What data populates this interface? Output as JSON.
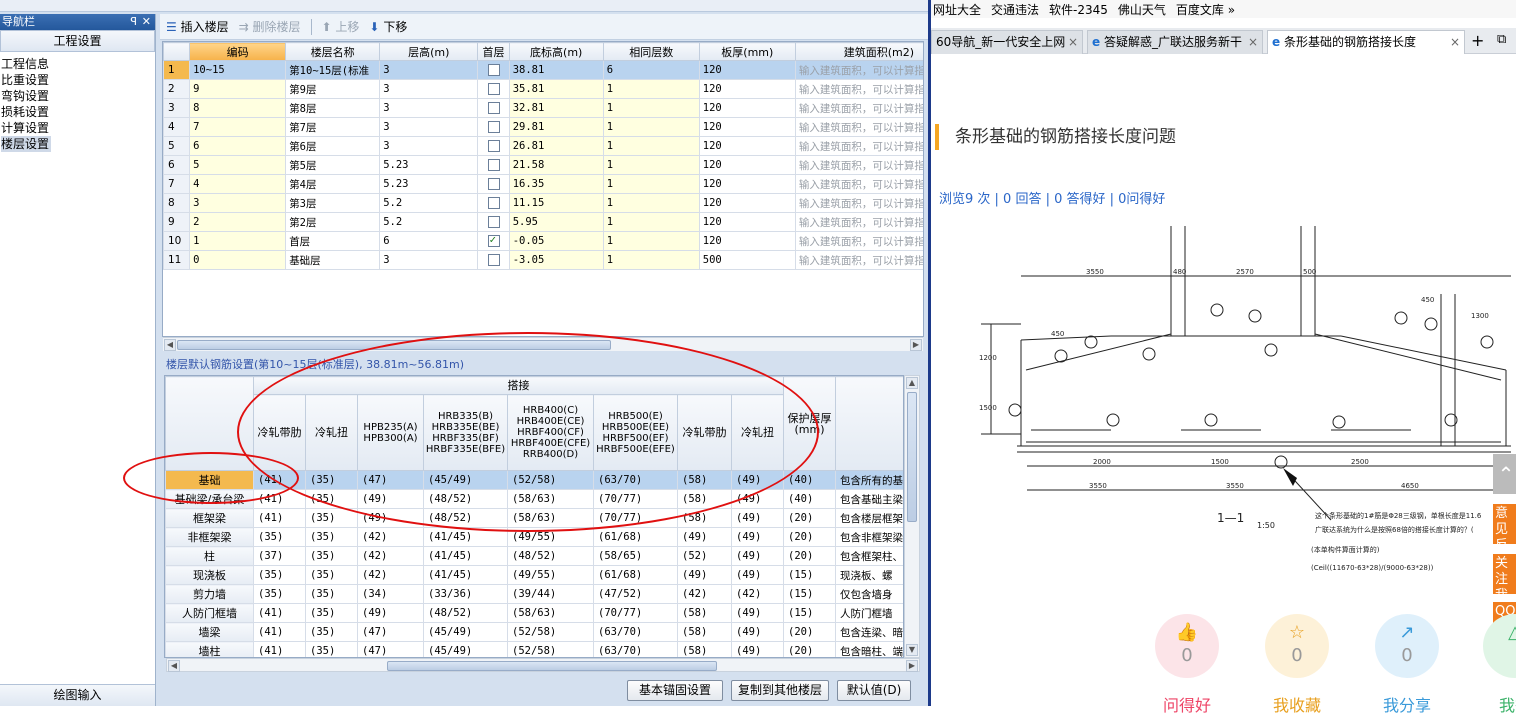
{
  "nav": {
    "title": "导航栏",
    "pin_glyph": "ꟼ",
    "close_glyph": "✕",
    "section_tab": "工程设置",
    "items": [
      "工程信息",
      "比重设置",
      "弯钩设置",
      "损耗设置",
      "计算设置",
      "楼层设置"
    ],
    "selected_index": 5,
    "bottom_tab": "绘图输入"
  },
  "toolbar": {
    "insert_floor": "插入楼层",
    "delete_floor": "删除楼层",
    "move_up": "上移",
    "move_down": "下移"
  },
  "floor_table": {
    "columns": [
      "",
      "编码",
      "楼层名称",
      "层高(m)",
      "首层",
      "底标高(m)",
      "相同层数",
      "板厚(mm)",
      "建筑面积(m2)"
    ],
    "placeholder_area": "输入建筑面积，可以计算指标",
    "rows": [
      {
        "no": "1",
        "code": "10~15",
        "name": "第10~15层(标准",
        "height": "3",
        "first": false,
        "bottom": "38.81",
        "same": "6",
        "thick": "120"
      },
      {
        "no": "2",
        "code": "9",
        "name": "第9层",
        "height": "3",
        "first": false,
        "bottom": "35.81",
        "same": "1",
        "thick": "120"
      },
      {
        "no": "3",
        "code": "8",
        "name": "第8层",
        "height": "3",
        "first": false,
        "bottom": "32.81",
        "same": "1",
        "thick": "120"
      },
      {
        "no": "4",
        "code": "7",
        "name": "第7层",
        "height": "3",
        "first": false,
        "bottom": "29.81",
        "same": "1",
        "thick": "120"
      },
      {
        "no": "5",
        "code": "6",
        "name": "第6层",
        "height": "3",
        "first": false,
        "bottom": "26.81",
        "same": "1",
        "thick": "120"
      },
      {
        "no": "6",
        "code": "5",
        "name": "第5层",
        "height": "5.23",
        "first": false,
        "bottom": "21.58",
        "same": "1",
        "thick": "120"
      },
      {
        "no": "7",
        "code": "4",
        "name": "第4层",
        "height": "5.23",
        "first": false,
        "bottom": "16.35",
        "same": "1",
        "thick": "120"
      },
      {
        "no": "8",
        "code": "3",
        "name": "第3层",
        "height": "5.2",
        "first": false,
        "bottom": "11.15",
        "same": "1",
        "thick": "120"
      },
      {
        "no": "9",
        "code": "2",
        "name": "第2层",
        "height": "5.2",
        "first": false,
        "bottom": "5.95",
        "same": "1",
        "thick": "120"
      },
      {
        "no": "10",
        "code": "1",
        "name": "首层",
        "height": "6",
        "first": true,
        "bottom": "-0.05",
        "same": "1",
        "thick": "120"
      },
      {
        "no": "11",
        "code": "0",
        "name": "基础层",
        "height": "3",
        "first": false,
        "bottom": "-3.05",
        "same": "1",
        "thick": "500"
      }
    ]
  },
  "rebar": {
    "label": "楼层默认钢筋设置(第10~15层(标准层), 38.81m~56.81m)",
    "group_header": "搭接",
    "columns": [
      "冷轧带肋",
      "冷轧扭",
      "HPB235(A)\nHPB300(A)",
      "HRB335(B)\nHRB335E(BE)\nHRBF335(BF)\nHRBF335E(BFE)",
      "HRB400(C)\nHRB400E(CE)\nHRBF400(CF)\nHRBF400E(CFE)\nRRB400(D)",
      "HRB500(E)\nHRB500E(EE)\nHRBF500(EF)\nHRBF500E(EFE)",
      "冷轧带肋",
      "冷轧扭",
      "保护层厚\n(mm)",
      ""
    ],
    "rows": [
      {
        "name": "基础",
        "v": [
          "(41)",
          "(35)",
          "(47)",
          "(45/49)",
          "(52/58)",
          "(63/70)",
          "(58)",
          "(49)",
          "(40)"
        ],
        "desc": "包含所有的基"
      },
      {
        "name": "基础梁/承台梁",
        "v": [
          "(41)",
          "(35)",
          "(49)",
          "(48/52)",
          "(58/63)",
          "(70/77)",
          "(58)",
          "(49)",
          "(40)"
        ],
        "desc": "包含基础主梁"
      },
      {
        "name": "框架梁",
        "v": [
          "(41)",
          "(35)",
          "(49)",
          "(48/52)",
          "(58/63)",
          "(70/77)",
          "(58)",
          "(49)",
          "(20)"
        ],
        "desc": "包含楼层框架"
      },
      {
        "name": "非框架梁",
        "v": [
          "(35)",
          "(35)",
          "(42)",
          "(41/45)",
          "(49/55)",
          "(61/68)",
          "(49)",
          "(49)",
          "(20)"
        ],
        "desc": "包含非框架梁"
      },
      {
        "name": "柱",
        "v": [
          "(37)",
          "(35)",
          "(42)",
          "(41/45)",
          "(48/52)",
          "(58/65)",
          "(52)",
          "(49)",
          "(20)"
        ],
        "desc": "包含框架柱、"
      },
      {
        "name": "现浇板",
        "v": [
          "(35)",
          "(35)",
          "(42)",
          "(41/45)",
          "(49/55)",
          "(61/68)",
          "(49)",
          "(49)",
          "(15)"
        ],
        "desc": "现浇板、螺"
      },
      {
        "name": "剪力墙",
        "v": [
          "(35)",
          "(35)",
          "(34)",
          "(33/36)",
          "(39/44)",
          "(47/52)",
          "(42)",
          "(42)",
          "(15)"
        ],
        "desc": "仅包含墙身"
      },
      {
        "name": "人防门框墙",
        "v": [
          "(41)",
          "(35)",
          "(49)",
          "(48/52)",
          "(58/63)",
          "(70/77)",
          "(58)",
          "(49)",
          "(15)"
        ],
        "desc": "人防门框墙"
      },
      {
        "name": "墙梁",
        "v": [
          "(41)",
          "(35)",
          "(47)",
          "(45/49)",
          "(52/58)",
          "(63/70)",
          "(58)",
          "(49)",
          "(20)"
        ],
        "desc": "包含连梁、暗"
      },
      {
        "name": "墙柱",
        "v": [
          "(41)",
          "(35)",
          "(47)",
          "(45/49)",
          "(52/58)",
          "(63/70)",
          "(58)",
          "(49)",
          "(20)"
        ],
        "desc": "包含暗柱、端"
      }
    ]
  },
  "buttons": {
    "anchor": "基本锚固设置",
    "copy": "复制到其他楼层",
    "default": "默认值(D)"
  },
  "browser": {
    "favorites": [
      "网址大全",
      "交通违法",
      "软件-2345",
      "佛山天气",
      "百度文库 »"
    ],
    "tabs": [
      "60导航_新一代安全上网",
      "答疑解惑_广联达服务新干",
      "条形基础的钢筋搭接长度"
    ],
    "question_title": "条形基础的钢筋搭接长度问题",
    "stats": "浏览9 次 | 0 回答 | 0 答得好 | 0问得好",
    "drawing_notes": [
      "这个条形基础的1#筋是Φ28三级钢，单根长度是11.6",
      "广联达系统为什么是按照68倍的搭接长度计算的？(",
      "(本单构件算面计算的)",
      "(Ceil((11670-63*28)/(9000-63*28))"
    ],
    "section_label": "1—1",
    "section_scale": "1:50",
    "dims": [
      "3550",
      "480",
      "2570",
      "500",
      "2000",
      "1500",
      "2500",
      "3550",
      "3550",
      "4650",
      "1200",
      "1500",
      "450",
      "450",
      "1300"
    ],
    "side_buttons": [
      "意见反馈",
      "关注我们",
      "QQ咨询"
    ],
    "actions": [
      {
        "icon": "👍",
        "count": "0",
        "label": "问得好"
      },
      {
        "icon": "☆",
        "count": "0",
        "label": "我收藏"
      },
      {
        "icon": "↗",
        "count": "0",
        "label": "我分享"
      },
      {
        "icon": "△",
        "count": "",
        "label": "我举"
      }
    ]
  }
}
